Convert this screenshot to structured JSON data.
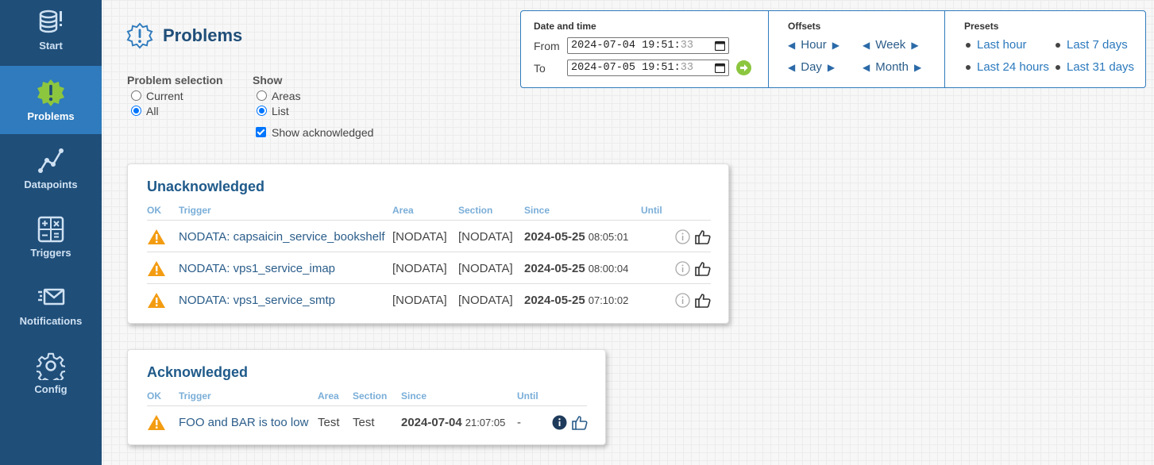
{
  "sidebar": {
    "items": [
      {
        "label": "Start",
        "icon": "database-alert-icon"
      },
      {
        "label": "Problems",
        "icon": "problem-badge-icon"
      },
      {
        "label": "Datapoints",
        "icon": "line-chart-icon"
      },
      {
        "label": "Triggers",
        "icon": "calculator-icon"
      },
      {
        "label": "Notifications",
        "icon": "envelope-icon"
      },
      {
        "label": "Config",
        "icon": "gear-icon"
      }
    ]
  },
  "page": {
    "title": "Problems"
  },
  "selection": {
    "title": "Problem selection",
    "options": [
      "Current",
      "All"
    ],
    "selected": "All"
  },
  "show": {
    "title": "Show",
    "options": [
      "Areas",
      "List"
    ],
    "selected": "List",
    "acknowledged_label": "Show acknowledged",
    "acknowledged_checked": true
  },
  "datetime": {
    "title": "Date and time",
    "from_label": "From",
    "from_value": "2024-07-04 19:51:",
    "from_seconds": "33",
    "to_label": "To",
    "to_value": "2024-07-05 19:51:",
    "to_seconds": "33"
  },
  "offsets": {
    "title": "Offsets",
    "hour": "Hour",
    "week": "Week",
    "day": "Day",
    "month": "Month"
  },
  "presets": {
    "title": "Presets",
    "last_hour": "Last hour",
    "last_7_days": "Last 7 days",
    "last_24_hours": "Last 24 hours",
    "last_31_days": "Last 31 days"
  },
  "unacknowledged": {
    "title": "Unacknowledged",
    "headers": {
      "ok": "OK",
      "trigger": "Trigger",
      "area": "Area",
      "section": "Section",
      "since": "Since",
      "until": "Until"
    },
    "rows": [
      {
        "trigger": "NODATA: capsaicin_service_bookshelf",
        "area": "[NODATA]",
        "section": "[NODATA]",
        "since_date": "2024-05-25",
        "since_time": "08:05:01",
        "until": ""
      },
      {
        "trigger": "NODATA: vps1_service_imap",
        "area": "[NODATA]",
        "section": "[NODATA]",
        "since_date": "2024-05-25",
        "since_time": "08:00:04",
        "until": ""
      },
      {
        "trigger": "NODATA: vps1_service_smtp",
        "area": "[NODATA]",
        "section": "[NODATA]",
        "since_date": "2024-05-25",
        "since_time": "07:10:02",
        "until": ""
      }
    ]
  },
  "acknowledged": {
    "title": "Acknowledged",
    "headers": {
      "ok": "OK",
      "trigger": "Trigger",
      "area": "Area",
      "section": "Section",
      "since": "Since",
      "until": "Until"
    },
    "rows": [
      {
        "trigger": "FOO and BAR is too low",
        "area": "Test",
        "section": "Test",
        "since_date": "2024-07-04",
        "since_time": "21:07:05",
        "until": "-"
      }
    ]
  },
  "colors": {
    "sidebar": "#1f4e79",
    "sidebar_active": "#2f7bbd",
    "accent_green": "#8cc63f",
    "warning": "#f39c12",
    "link": "#2b79bd"
  }
}
